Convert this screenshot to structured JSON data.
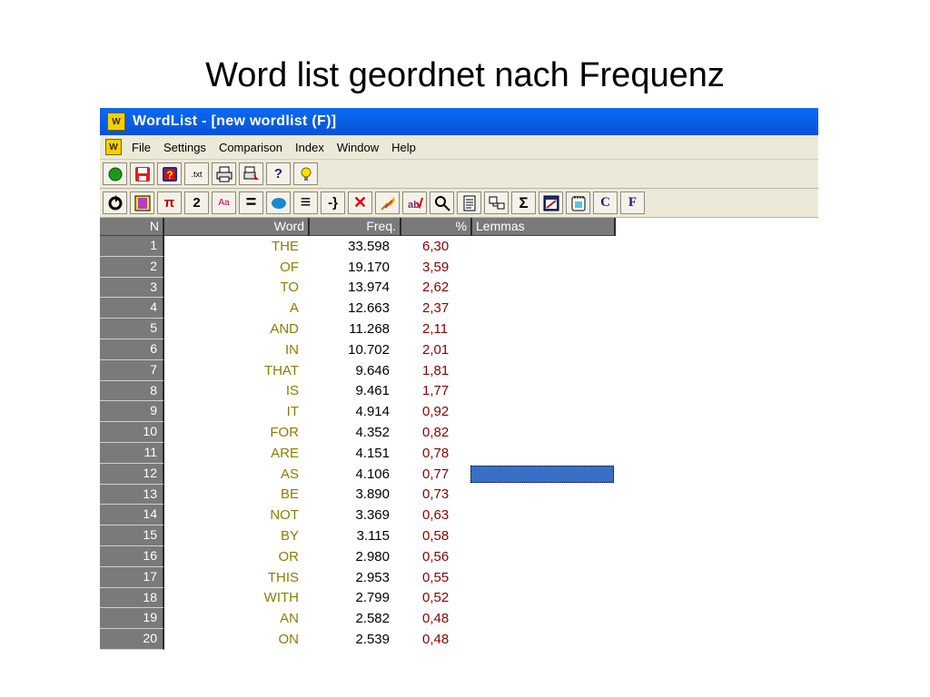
{
  "slide": {
    "title": "Word list geordnet nach Frequenz"
  },
  "window": {
    "app_icon_text": "W",
    "title": "WordList - [new wordlist (F)]"
  },
  "menu": [
    "File",
    "Settings",
    "Comparison",
    "Index",
    "Window",
    "Help"
  ],
  "toolbar1": [
    {
      "icon": "green-circle-icon"
    },
    {
      "icon": "save-icon"
    },
    {
      "icon": "help-book-icon"
    },
    {
      "icon": "txt-icon",
      "label": ".txt"
    },
    {
      "icon": "print-icon"
    },
    {
      "icon": "print-preview-icon"
    },
    {
      "icon": "question-icon",
      "label": "?"
    },
    {
      "icon": "lightbulb-icon"
    }
  ],
  "toolbar2": [
    {
      "icon": "refresh-icon"
    },
    {
      "icon": "columns-icon"
    },
    {
      "icon": "pi-icon",
      "label": "π"
    },
    {
      "icon": "two-icon",
      "label": "2"
    },
    {
      "icon": "case-icon",
      "label": "Aa"
    },
    {
      "icon": "equals-icon",
      "label": "="
    },
    {
      "icon": "blue-oval-icon"
    },
    {
      "icon": "lines-icon",
      "label": "≡"
    },
    {
      "icon": "brace-icon",
      "label": "-}"
    },
    {
      "icon": "red-x-icon",
      "label": "✕"
    },
    {
      "icon": "broom-icon"
    },
    {
      "icon": "mark-icon"
    },
    {
      "icon": "search-icon"
    },
    {
      "icon": "document-icon"
    },
    {
      "icon": "boxes-icon"
    },
    {
      "icon": "sigma-icon",
      "label": "Σ"
    },
    {
      "icon": "window-icon"
    },
    {
      "icon": "notepad-icon"
    },
    {
      "icon": "c-icon",
      "label": "C"
    },
    {
      "icon": "f-icon",
      "label": "F"
    }
  ],
  "table": {
    "headers": {
      "n": "N",
      "word": "Word",
      "freq": "Freq.",
      "pct": "%",
      "lemmas": "Lemmas"
    },
    "selected_row": 12,
    "rows": [
      {
        "n": "1",
        "word": "THE",
        "freq": "33.598",
        "pct": "6,30"
      },
      {
        "n": "2",
        "word": "OF",
        "freq": "19.170",
        "pct": "3,59"
      },
      {
        "n": "3",
        "word": "TO",
        "freq": "13.974",
        "pct": "2,62"
      },
      {
        "n": "4",
        "word": "A",
        "freq": "12.663",
        "pct": "2,37"
      },
      {
        "n": "5",
        "word": "AND",
        "freq": "11.268",
        "pct": "2,11"
      },
      {
        "n": "6",
        "word": "IN",
        "freq": "10.702",
        "pct": "2,01"
      },
      {
        "n": "7",
        "word": "THAT",
        "freq": "9.646",
        "pct": "1,81"
      },
      {
        "n": "8",
        "word": "IS",
        "freq": "9.461",
        "pct": "1,77"
      },
      {
        "n": "9",
        "word": "IT",
        "freq": "4.914",
        "pct": "0,92"
      },
      {
        "n": "10",
        "word": "FOR",
        "freq": "4.352",
        "pct": "0,82"
      },
      {
        "n": "11",
        "word": "ARE",
        "freq": "4.151",
        "pct": "0,78"
      },
      {
        "n": "12",
        "word": "AS",
        "freq": "4.106",
        "pct": "0,77"
      },
      {
        "n": "13",
        "word": "BE",
        "freq": "3.890",
        "pct": "0,73"
      },
      {
        "n": "14",
        "word": "NOT",
        "freq": "3.369",
        "pct": "0,63"
      },
      {
        "n": "15",
        "word": "BY",
        "freq": "3.115",
        "pct": "0,58"
      },
      {
        "n": "16",
        "word": "OR",
        "freq": "2.980",
        "pct": "0,56"
      },
      {
        "n": "17",
        "word": "THIS",
        "freq": "2.953",
        "pct": "0,55"
      },
      {
        "n": "18",
        "word": "WITH",
        "freq": "2.799",
        "pct": "0,52"
      },
      {
        "n": "19",
        "word": "AN",
        "freq": "2.582",
        "pct": "0,48"
      },
      {
        "n": "20",
        "word": "ON",
        "freq": "2.539",
        "pct": "0,48"
      }
    ]
  },
  "colors": {
    "titlebar": "#0753d6",
    "word_text": "#8b7d00",
    "pct_text": "#8b0000",
    "selection": "#3a6fc8"
  }
}
